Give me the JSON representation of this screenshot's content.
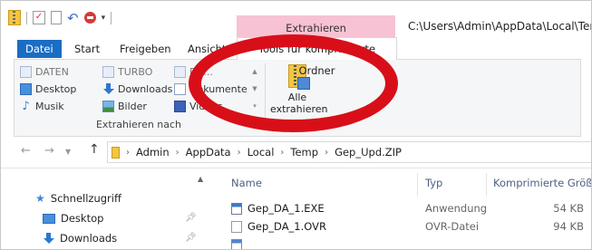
{
  "window": {
    "context_tab_group": "Extrahieren",
    "path_title": "C:\\Users\\Admin\\AppData\\Local\\Temp\\G"
  },
  "ribbon_tabs": [
    {
      "label": "Datei"
    },
    {
      "label": "Start"
    },
    {
      "label": "Freigeben"
    },
    {
      "label": "Ansicht"
    },
    {
      "label": "Tools für komprimierte Ordner"
    }
  ],
  "extract_to": {
    "group_label": "Extrahieren nach",
    "items": [
      {
        "label": "DATEN",
        "icon": "doc-folder-icon",
        "dimmed": true
      },
      {
        "label": "TURBO",
        "icon": "doc-folder-icon",
        "dimmed": true
      },
      {
        "label": "DE...",
        "icon": "doc-folder-icon",
        "dimmed": true
      },
      {
        "label": "Desktop",
        "icon": "desktop-icon"
      },
      {
        "label": "Downloads",
        "icon": "downloads-icon"
      },
      {
        "label": "Dokumente",
        "icon": "documents-icon"
      },
      {
        "label": "Musik",
        "icon": "music-icon"
      },
      {
        "label": "Bilder",
        "icon": "pictures-icon"
      },
      {
        "label": "Videos",
        "icon": "videos-icon"
      }
    ]
  },
  "extract_all_button": {
    "line1": "Alle",
    "line2": "extrahieren"
  },
  "address": {
    "segments": [
      "Admin",
      "AppData",
      "Local",
      "Temp",
      "Gep_Upd.ZIP"
    ]
  },
  "nav_pane": {
    "quick_access": "Schnellzugriff",
    "items": [
      {
        "label": "Desktop"
      },
      {
        "label": "Downloads"
      }
    ]
  },
  "file_list": {
    "columns": {
      "name": "Name",
      "type": "Typ",
      "size": "Komprimierte Größe"
    },
    "rows": [
      {
        "name": "Gep_DA_1.EXE",
        "type": "Anwendung",
        "size": "54 KB",
        "icon": "exe-icon"
      },
      {
        "name": "Gep_DA_1.OVR",
        "type": "OVR-Datei",
        "size": "94 KB",
        "icon": "ovr-icon"
      }
    ]
  },
  "colors": {
    "file_tab": "#1a6dc4",
    "context_tab": "#f7c2d3",
    "annotation_ring": "#d80f18"
  }
}
